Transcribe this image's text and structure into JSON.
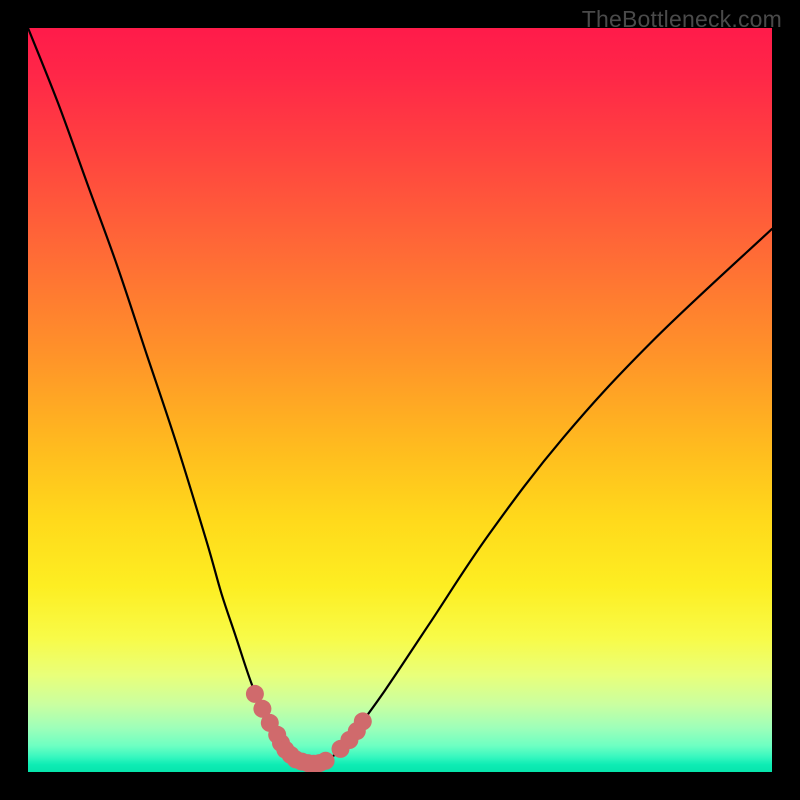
{
  "watermark": "TheBottleneck.com",
  "chart_data": {
    "type": "line",
    "title": "",
    "xlabel": "",
    "ylabel": "",
    "x_range": [
      0,
      100
    ],
    "y_range": [
      0,
      100
    ],
    "curve": {
      "name": "bottleneck-curve",
      "x": [
        0,
        4,
        8,
        12,
        16,
        20,
        24,
        26,
        28,
        30,
        32,
        34,
        35,
        36,
        37,
        38,
        40,
        42,
        44,
        48,
        54,
        62,
        72,
        84,
        100
      ],
      "y": [
        100,
        90,
        79,
        68,
        56,
        44,
        31,
        24,
        18,
        12,
        7,
        3.5,
        2,
        1.2,
        0.8,
        0.9,
        1.5,
        3,
        5.5,
        11,
        20,
        32,
        45,
        58,
        73
      ]
    },
    "highlight_points": {
      "name": "optimal-region",
      "color": "#d06a6c",
      "x": [
        30.5,
        31.5,
        32.5,
        33.5,
        34.0,
        34.6,
        35.3,
        36.0,
        36.8,
        37.6,
        38.4,
        39.2,
        40.0,
        42.0,
        43.2,
        44.2,
        45.0
      ],
      "y": [
        10.5,
        8.5,
        6.6,
        5.0,
        3.9,
        3.0,
        2.3,
        1.7,
        1.4,
        1.2,
        1.1,
        1.2,
        1.5,
        3.1,
        4.3,
        5.5,
        6.8
      ]
    },
    "gradient_stops": [
      {
        "pos": 0.0,
        "color": "#ff1b4a"
      },
      {
        "pos": 0.3,
        "color": "#ff6a36"
      },
      {
        "pos": 0.66,
        "color": "#ffd91b"
      },
      {
        "pos": 0.87,
        "color": "#e9ff7a"
      },
      {
        "pos": 1.0,
        "color": "#07e5ac"
      }
    ]
  }
}
